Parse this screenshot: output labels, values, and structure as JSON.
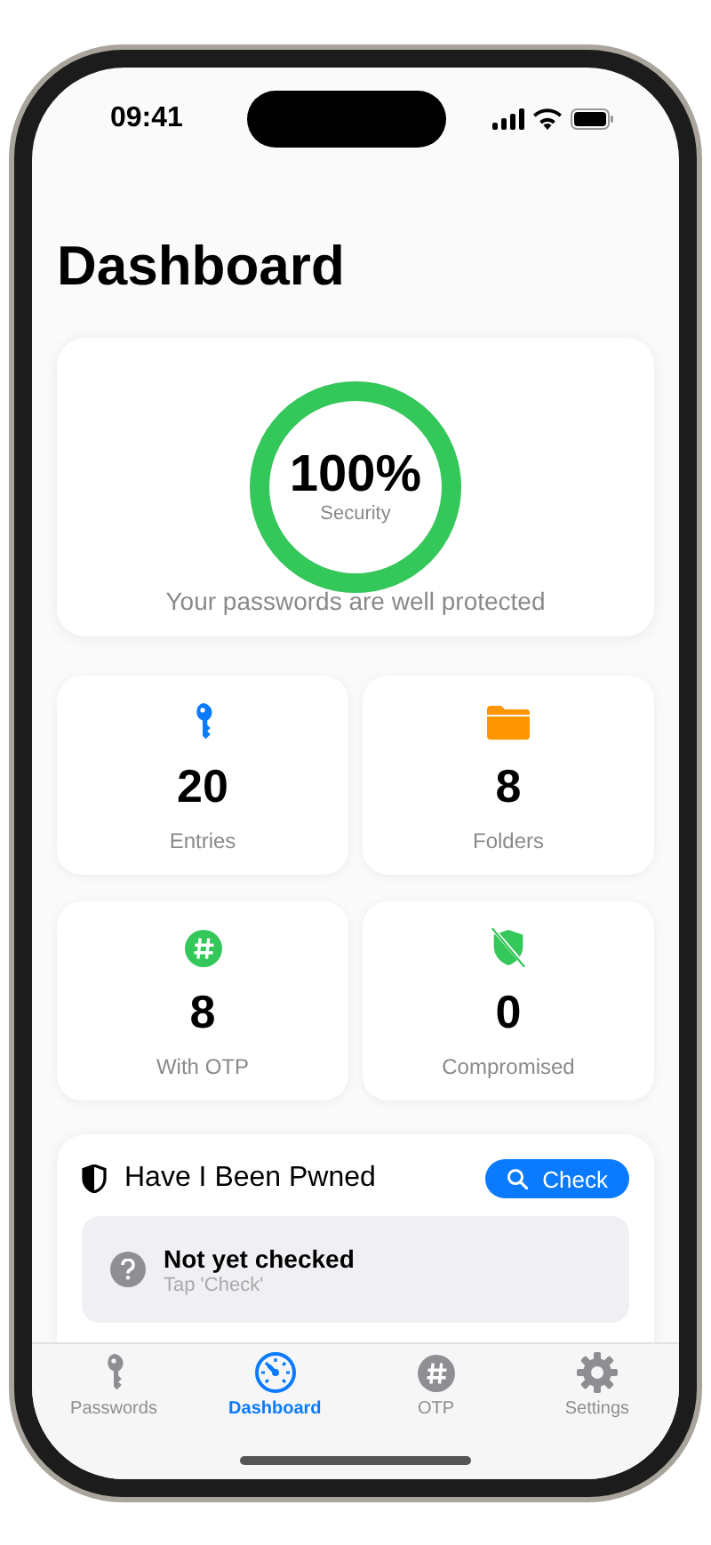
{
  "status_bar": {
    "time": "09:41"
  },
  "title": "Dashboard",
  "security": {
    "value": "100%",
    "label": "Security",
    "level": 1.0,
    "message": "Your passwords are well protected"
  },
  "stats": [
    {
      "kind": "key",
      "value": "20",
      "label": "Entries"
    },
    {
      "kind": "folder",
      "value": "8",
      "label": "Folders"
    },
    {
      "kind": "otp",
      "value": "8",
      "label": "With OTP"
    },
    {
      "kind": "shield",
      "value": "0",
      "label": "Compromised"
    }
  ],
  "pwned": {
    "title": "Have I Been Pwned",
    "button": "Check",
    "status_title": "Not yet checked",
    "status_subtitle": "Tap 'Check'"
  },
  "tabs": [
    {
      "kind": "key",
      "label": "Passwords",
      "selected": false
    },
    {
      "kind": "gauge",
      "label": "Dashboard",
      "selected": true
    },
    {
      "kind": "otp",
      "label": "OTP",
      "selected": false
    },
    {
      "kind": "gear",
      "label": "Settings",
      "selected": false
    }
  ]
}
